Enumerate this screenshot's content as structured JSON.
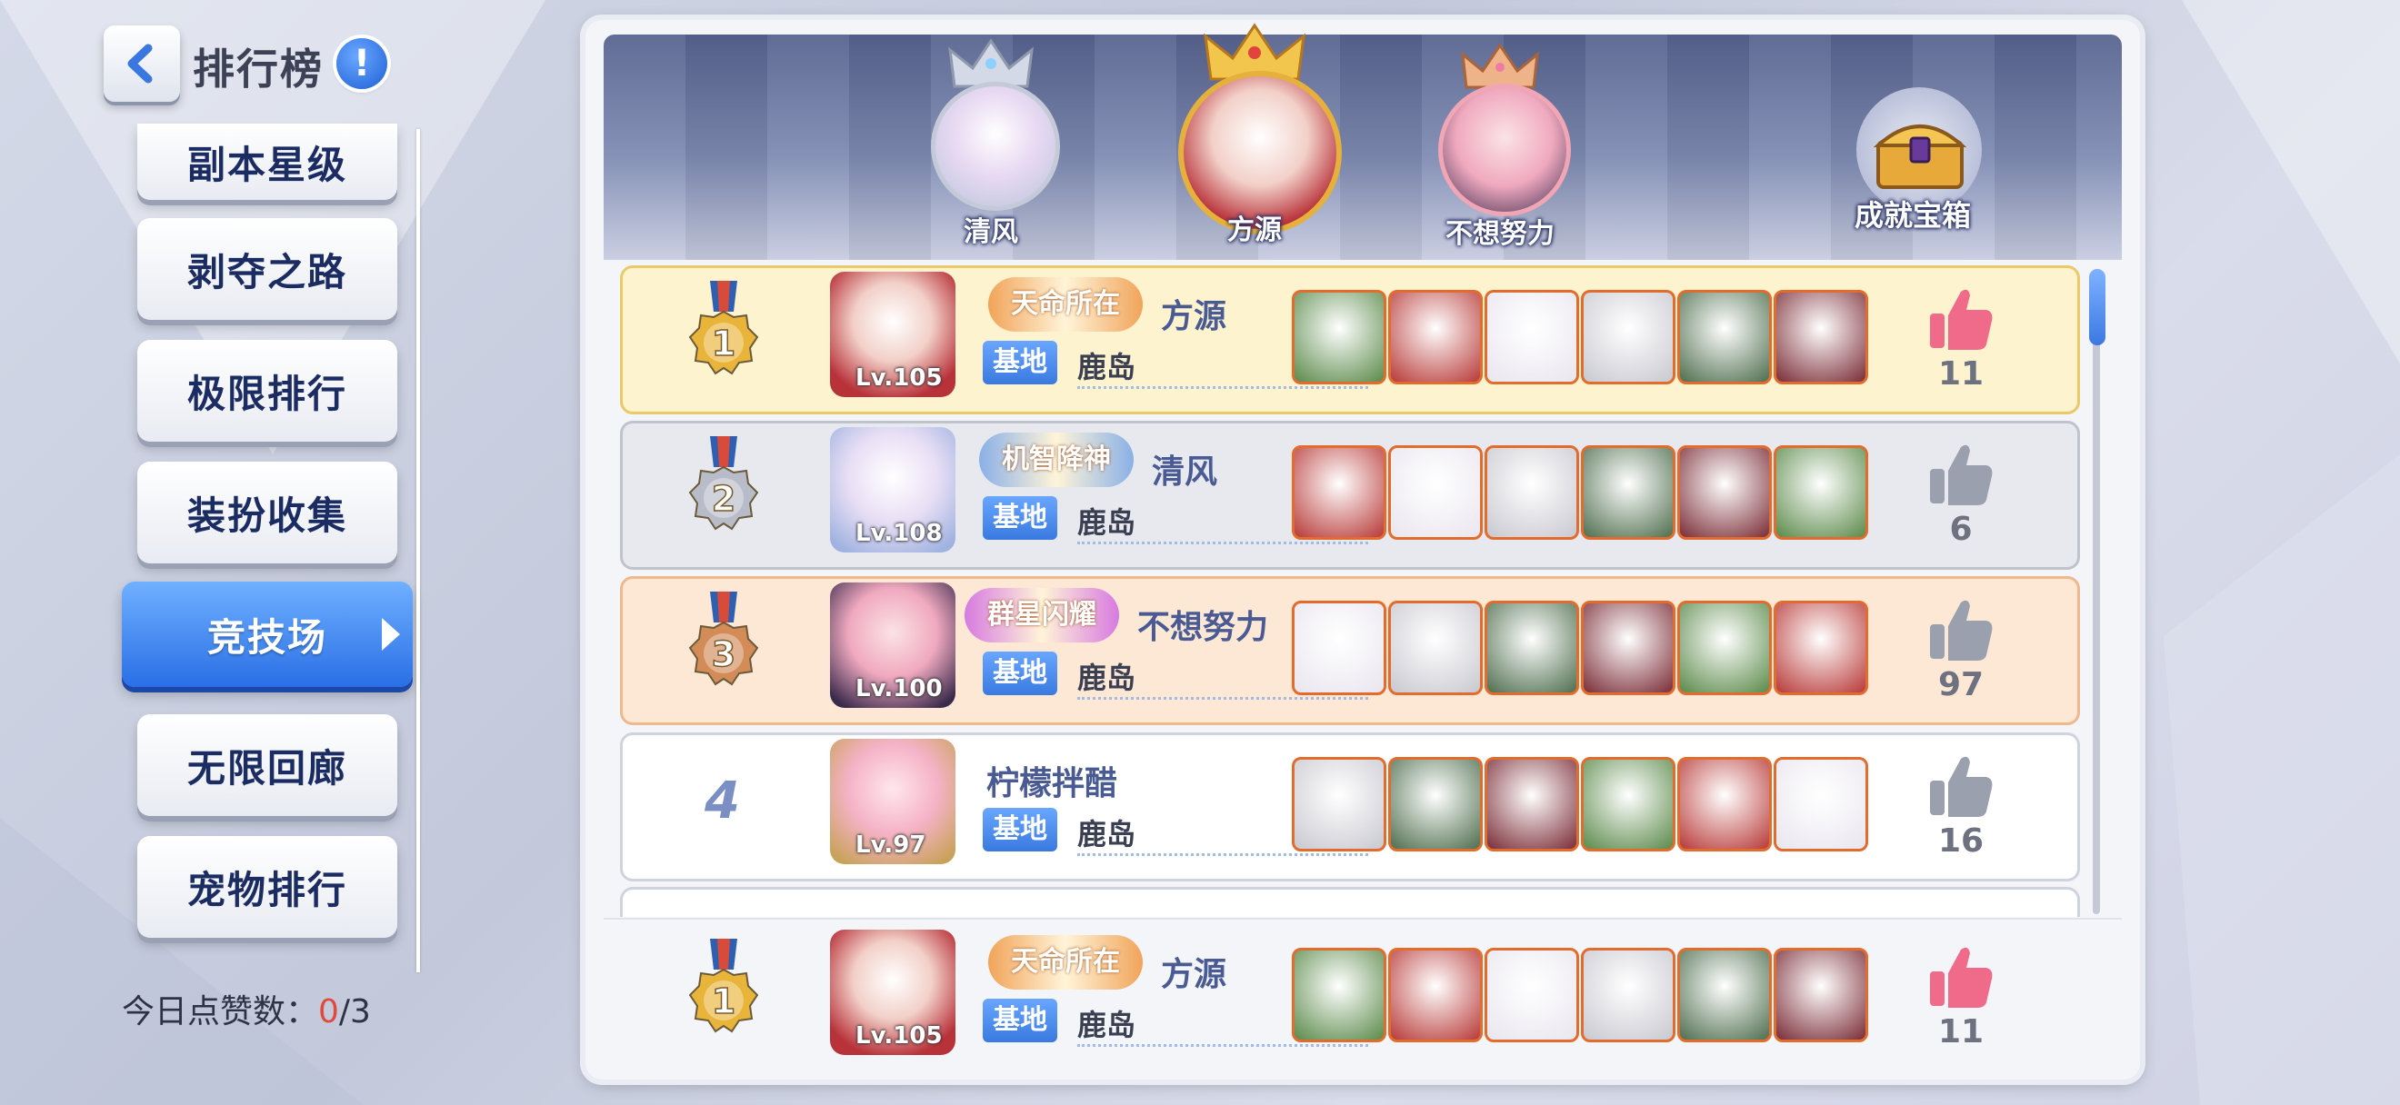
{
  "header": {
    "title": "排行榜",
    "info": "!"
  },
  "menu": {
    "items": [
      {
        "label": "副本星级"
      },
      {
        "label": "剥夺之路"
      },
      {
        "label": "极限排行"
      },
      {
        "label": "装扮收集"
      },
      {
        "label": "竞技场"
      },
      {
        "label": "无限回廊"
      },
      {
        "label": "宠物排行"
      }
    ],
    "active_index": 4
  },
  "likes_today": {
    "label": "今日点赞数：",
    "used": "0",
    "total": "/3"
  },
  "podium": {
    "first": "方源",
    "second": "清风",
    "third": "不想努力"
  },
  "achievement_chest": {
    "label": "成就宝箱"
  },
  "rows": [
    {
      "rank": "1",
      "level": "Lv.105",
      "name": "方源",
      "base_tag": "基地",
      "base": "鹿岛",
      "likes": "11",
      "liked": true,
      "title_text": "天命所在",
      "title_color": "#f1a45a"
    },
    {
      "rank": "2",
      "level": "Lv.108",
      "name": "清风",
      "base_tag": "基地",
      "base": "鹿岛",
      "likes": "6",
      "liked": false,
      "title_text": "机智降神",
      "title_color": "#8ab0e6"
    },
    {
      "rank": "3",
      "level": "Lv.100",
      "name": "不想努力",
      "base_tag": "基地",
      "base": "鹿岛",
      "likes": "97",
      "liked": false,
      "title_text": "群星闪耀",
      "title_color": "#d77ae0"
    },
    {
      "rank": "4",
      "level": "Lv.97",
      "name": "柠檬拌醋",
      "base_tag": "基地",
      "base": "鹿岛",
      "likes": "16",
      "liked": false,
      "title_text": "",
      "title_color": ""
    }
  ],
  "my_row": {
    "rank": "1",
    "level": "Lv.105",
    "name": "方源",
    "base_tag": "基地",
    "base": "鹿岛",
    "likes": "11",
    "liked": true,
    "title_text": "天命所在",
    "title_color": "#f1a45a"
  },
  "colors": {
    "accent": "#2a6fe6",
    "like_active": "#f06b8a",
    "like_inactive": "#9aa0ad",
    "gold": "#e8b43a",
    "silver": "#b7bcc8",
    "bronze": "#d38b58"
  },
  "icons": {
    "back": "chevron-left-icon",
    "info": "exclamation-icon",
    "like": "thumbs-up-icon",
    "chest": "treasure-chest-icon",
    "crown": "crown-icon",
    "medal": "medal-icon"
  }
}
